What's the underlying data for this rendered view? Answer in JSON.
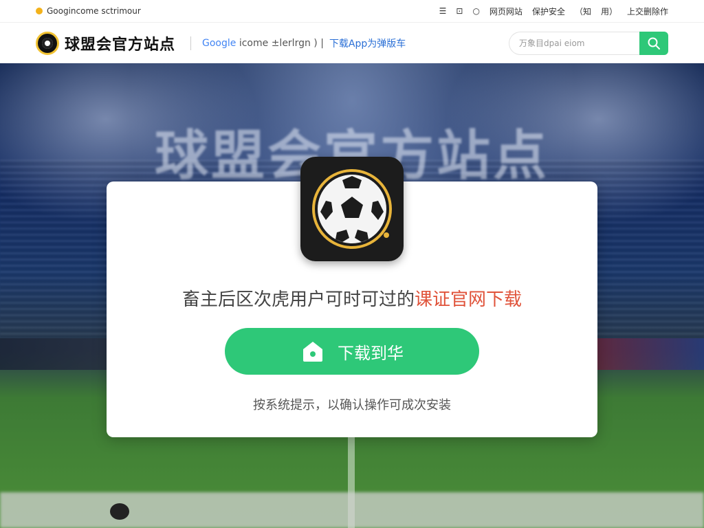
{
  "util_bar": {
    "left_text": "Googincome sctrimour",
    "links": [
      "☰",
      "⊡",
      "○",
      "网页网站",
      "保护安全",
      "（知",
      "用）",
      "上交删除作"
    ]
  },
  "header": {
    "brand": "球盟会官方站点",
    "google_text": "Google",
    "google_suffix": "icome ±lerlrgn ) |",
    "download_link": "下载App为弹版车",
    "search_placeholder": "万象目dpai eiom"
  },
  "background": {
    "title": "球盟会官方站点"
  },
  "card": {
    "headline_main": "畜主后区次虎用户可时可过的",
    "headline_accent": "课证官网下载",
    "button_label": "下载到华",
    "hint": "按系统提示，以确认操作可成次安装"
  },
  "colors": {
    "accent_green": "#2ec878",
    "accent_red": "#e0533a",
    "logo_gold": "#f1c232"
  }
}
